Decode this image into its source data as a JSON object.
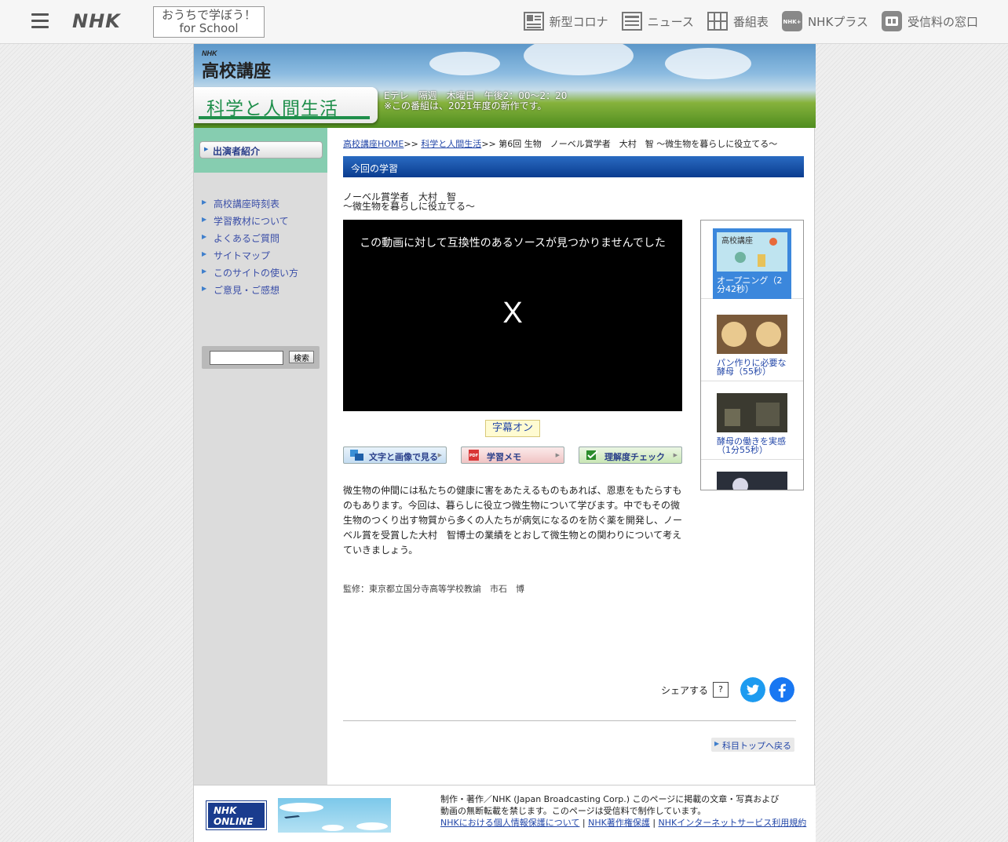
{
  "topbar": {
    "logo": "NHK",
    "school_line1": "おうちで学ぼう！",
    "school_line2": "for School",
    "nav": [
      {
        "label": "新型コロナ",
        "icon": "corona-icon"
      },
      {
        "label": "ニュース",
        "icon": "news-icon"
      },
      {
        "label": "番組表",
        "icon": "program-guide-icon"
      },
      {
        "label": "NHKプラス",
        "icon": "nhk-plus-icon"
      },
      {
        "label": "受信料の窓口",
        "icon": "reception-fee-icon"
      }
    ]
  },
  "banner": {
    "brand_small": "NHK",
    "brand": "高校講座",
    "program_title": "科学と人間生活",
    "broadcast_line1": "Eテレ　隔週　木曜日　午後2：00〜2：20",
    "broadcast_line2": "※この番組は、2021年度の新作です。"
  },
  "sidebar": {
    "head_button": "出演者紹介",
    "links": [
      "高校講座時刻表",
      "学習教材について",
      "よくあるご質問",
      "サイトマップ",
      "このサイトの使い方",
      "ご意見・ご感想"
    ],
    "search_placeholder": "",
    "search_button": "検索"
  },
  "breadcrumb": {
    "home": "高校講座HOME",
    "sep1": ">>",
    "subject": "科学と人間生活",
    "sep2": ">>",
    "current": "第6回 生物　ノーベル賞学者　大村　智 ～微生物を暮らしに役立てる～"
  },
  "section": {
    "title": "今回の学習"
  },
  "episode": {
    "title_line1": "ノーベル賞学者　大村　智",
    "title_line2": "～微生物を暮らしに役立てる～"
  },
  "video": {
    "error_message": "この動画に対して互換性のあるソースが見つかりませんでした",
    "close": "X"
  },
  "caption_button": "字幕オン",
  "tools": [
    {
      "label": "文字と画像で見る",
      "icon": "text-image-icon",
      "color": "#cfe3f5"
    },
    {
      "label": "学習メモ",
      "icon": "pdf-icon",
      "color": "#f7d4d4"
    },
    {
      "label": "理解度チェック",
      "icon": "check-icon",
      "color": "#d5ecc8"
    }
  ],
  "description": "微生物の仲間には私たちの健康に害をあたえるものもあれば、恩恵をもたらすものもあります。今回は、暮らしに役立つ微生物について学びます。中でもその微生物のつくり出す物質から多くの人たちが病気になるのを防ぐ薬を開発し、ノーベル賞を受賞した大村　智博士の業績をとおして微生物との関わりについて考えていきましょう。",
  "supervisor": "監修：東京都立国分寺高等学校教諭　市石　博",
  "playlist": [
    {
      "label": "オープニング（2分42秒）",
      "active": true
    },
    {
      "label": "パン作りに必要な酵母（55秒）",
      "active": false
    },
    {
      "label": "酵母の働きを実感（1分55秒）",
      "active": false
    },
    {
      "label": "",
      "active": false
    }
  ],
  "share": {
    "label": "シェアする",
    "help": "?"
  },
  "back_button": "科目トップへ戻る",
  "footer": {
    "online_logo_line1": "NHK",
    "online_logo_line2": "ONLINE",
    "text_line1": "制作・著作／NHK (Japan Broadcasting Corp.) このページに掲載の文章・写真および",
    "text_line2": "動画の無断転載を禁じます。このページは受信料で制作しています。",
    "links": [
      "NHKにおける個人情報保護について",
      "NHK著作権保護",
      "NHKインターネットサービス利用規約"
    ],
    "link_sep": "|"
  },
  "colors": {
    "accent_green": "#1f8f4b",
    "link_blue": "#2347a8",
    "section_blue": "#0a3c8f",
    "twitter": "#1d9bf0",
    "facebook": "#1877f2"
  }
}
